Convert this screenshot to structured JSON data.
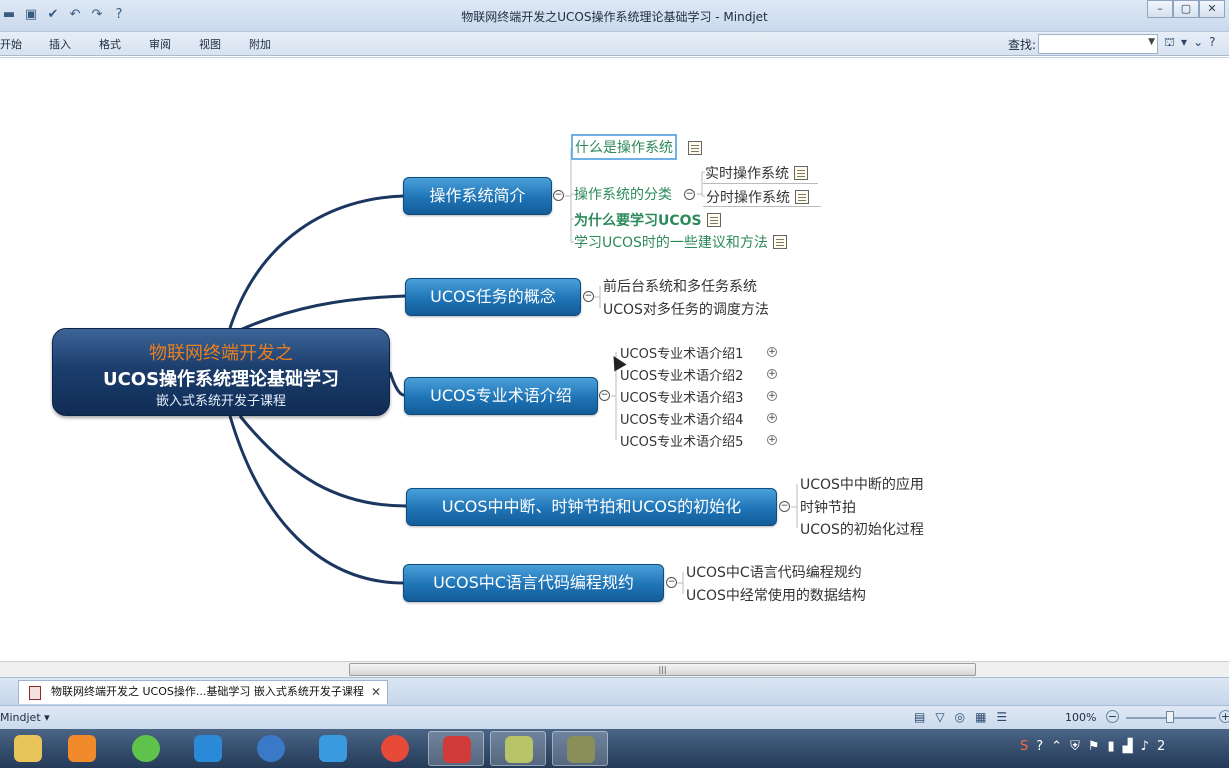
{
  "window": {
    "title": "物联网终端开发之UCOS操作系统理论基础学习 - Mindjet",
    "buttons": [
      "–",
      "▢",
      "✕"
    ]
  },
  "quick_access": [
    "open-icon",
    "save-icon",
    "check-icon",
    "undo-icon",
    "redo-icon",
    "help-icon"
  ],
  "ribbon": {
    "tabs": [
      "开始",
      "插入",
      "格式",
      "审阅",
      "视图",
      "附加"
    ],
    "find_label": "查找:",
    "find_value": ""
  },
  "map": {
    "central": {
      "line1": "物联网终端开发之",
      "line2": "UCOS操作系统理论基础学习",
      "line3": "嵌入式系统开发子课程"
    },
    "topics": [
      {
        "label": "操作系统简介",
        "subtopics": [
          "什么是操作系统",
          "操作系统的分类",
          "为什么要学习UCOS",
          "学习UCOS时的一些建议和方法"
        ],
        "classification_children": [
          "实时操作系统",
          "分时操作系统"
        ]
      },
      {
        "label": "UCOS任务的概念",
        "subtopics": [
          "前后台系统和多任务系统",
          "UCOS对多任务的调度方法"
        ]
      },
      {
        "label": "UCOS专业术语介绍",
        "subtopics": [
          "UCOS专业术语介绍1",
          "UCOS专业术语介绍2",
          "UCOS专业术语介绍3",
          "UCOS专业术语介绍4",
          "UCOS专业术语介绍5"
        ]
      },
      {
        "label": "UCOS中中断、时钟节拍和UCOS的初始化",
        "subtopics": [
          "UCOS中中断的应用",
          "时钟节拍",
          "UCOS的初始化过程"
        ]
      },
      {
        "label": "UCOS中C语言代码编程规约",
        "subtopics": [
          "UCOS中C语言代码编程规约",
          "UCOS中经常使用的数据结构"
        ]
      }
    ]
  },
  "doc_tab": {
    "label": "物联网终端开发之 UCOS操作...基础学习 嵌入式系统开发子课程",
    "close": "✕"
  },
  "status": {
    "app": "Mindjet ▾",
    "zoom": "100%"
  },
  "taskbar": {
    "clock_fragment": "2"
  },
  "colors": {
    "central_bg": "#1c3e6d",
    "topic_bg": "#1f74b6",
    "central_accent": "#e8801e",
    "subtopic_green": "#2c8a5a"
  }
}
